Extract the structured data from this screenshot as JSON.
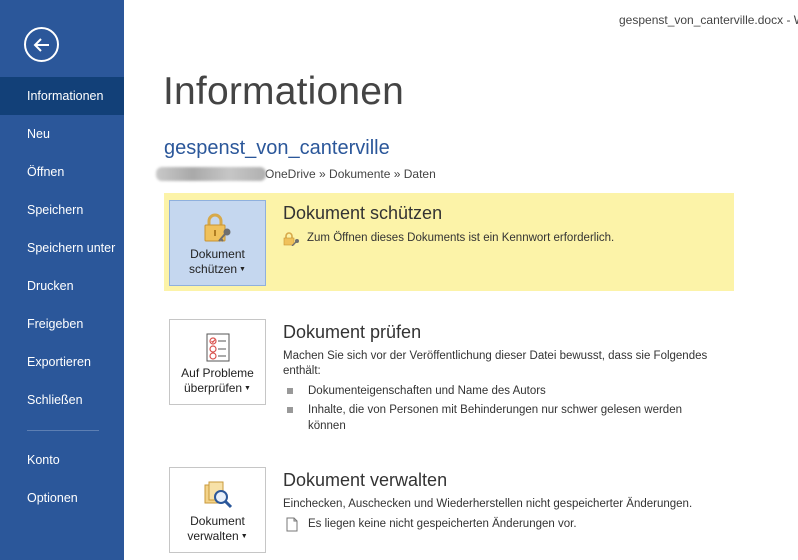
{
  "window": {
    "title": "gespenst_von_canterville.docx - W"
  },
  "sidebar": {
    "items": [
      {
        "label": "Informationen"
      },
      {
        "label": "Neu"
      },
      {
        "label": "Öffnen"
      },
      {
        "label": "Speichern"
      },
      {
        "label": "Speichern unter"
      },
      {
        "label": "Drucken"
      },
      {
        "label": "Freigeben"
      },
      {
        "label": "Exportieren"
      },
      {
        "label": "Schließen"
      },
      {
        "label": "Konto"
      },
      {
        "label": "Optionen"
      }
    ],
    "active_index": 0,
    "colors": {
      "background": "#2b579a",
      "active": "#124078"
    }
  },
  "main": {
    "title": "Informationen",
    "doc_name": "gespenst_von_canterville",
    "doc_path": "OneDrive » Dokumente » Daten",
    "sections": {
      "protect": {
        "button_label_line1": "Dokument",
        "button_label_line2": "schützen",
        "title": "Dokument schützen",
        "description": "Zum Öffnen dieses Dokuments ist ein Kennwort erforderlich.",
        "icon": "lock-key-icon",
        "highlight_color": "#fcf3a8"
      },
      "inspect": {
        "button_label_line1": "Auf Probleme",
        "button_label_line2": "überprüfen",
        "title": "Dokument prüfen",
        "description_line1": "Machen Sie sich vor der Veröffentlichung dieser Datei bewusst, dass sie Folgendes",
        "description_line2": "enthält:",
        "bullets": [
          {
            "line1": "Dokumenteigenschaften und Name des Autors",
            "line2": ""
          },
          {
            "line1": "Inhalte, die von Personen mit Behinderungen nur schwer gelesen werden",
            "line2": "können"
          }
        ],
        "icon": "checklist-icon"
      },
      "manage": {
        "button_label_line1": "Dokument",
        "button_label_line2": "verwalten",
        "title": "Dokument verwalten",
        "description": "Einchecken, Auschecken und Wiederherstellen nicht gespeicherter Änderungen.",
        "note": "Es liegen keine nicht gespeicherten Änderungen vor.",
        "icon": "manage-document-icon"
      }
    }
  }
}
